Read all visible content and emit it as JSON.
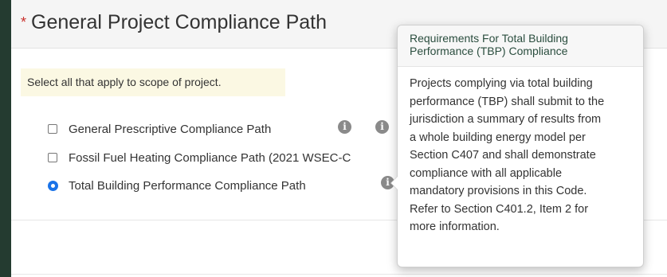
{
  "panel": {
    "required_marker": "*",
    "title": "General Project Compliance Path",
    "instruction": "Select all that apply to scope of project."
  },
  "options": [
    {
      "label": "General Prescriptive Compliance Path",
      "type": "checkbox",
      "checked": false,
      "info_icons": 2
    },
    {
      "label": "Fossil Fuel Heating Compliance Path (2021 WSEC-C",
      "type": "checkbox",
      "checked": false,
      "info_icons": 0
    },
    {
      "label": "Total Building Performance Compliance Path",
      "type": "radio",
      "checked": true,
      "info_icons": 1
    }
  ],
  "info_glyph": "i",
  "popover": {
    "title_line1": "Requirements For Total Building",
    "title_line2": "Performance (TBP) Compliance",
    "body_lines": [
      "Projects complying via total building",
      "performance (TBP) shall submit to the",
      "jurisdiction a summary of results from",
      "a whole building energy model per",
      "Section C407 and shall demonstrate",
      "compliance with all applicable",
      "mandatory provisions in this Code.",
      "Refer to Section C401.2, Item 2 for",
      "more information."
    ]
  },
  "colors": {
    "background": "#243b30",
    "required": "#c9302c",
    "radio": "#1a73e8",
    "instruction_bg": "#fbf8e3",
    "popover_title": "#2a4d3e"
  }
}
